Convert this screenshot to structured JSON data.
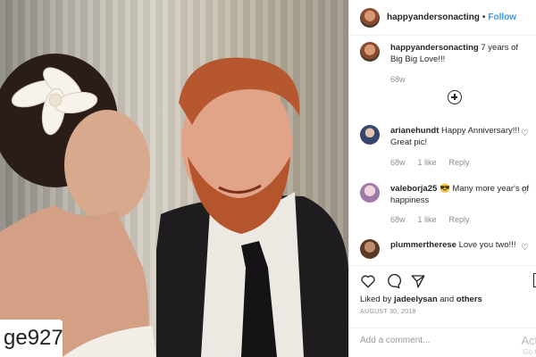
{
  "photo": {
    "watermark_text": "ge927"
  },
  "post_header": {
    "username": "happyandersonacting",
    "separator": "•",
    "follow_label": "Follow"
  },
  "caption": {
    "username": "happyandersonacting",
    "text": "7 years of Big Big Love!!!",
    "time": "68w"
  },
  "comments": [
    {
      "username": "arianehundt",
      "text": "Happy Anniversary!!! Great pic!",
      "time": "68w",
      "likes": "1 like",
      "reply": "Reply"
    },
    {
      "username": "valeborja25",
      "text": "😎 Many more year's of happiness",
      "time": "68w",
      "likes": "1 like",
      "reply": "Reply"
    },
    {
      "username": "plummertherese",
      "text": "Love you two!!!"
    }
  ],
  "engagement": {
    "liked_by_prefix": "Liked by",
    "liked_by_user": "jadeelysan",
    "and": "and",
    "others": "others",
    "date": "AUGUST 30, 2018"
  },
  "add_comment": {
    "placeholder": "Add a comment..."
  },
  "overlay": {
    "activate": "Acti",
    "activate_sub": "Go to"
  },
  "icons": {
    "load_more": "plus-circle-icon",
    "like": "heart-icon",
    "comment": "comment-bubble-icon",
    "share": "paper-plane-icon",
    "save": "bookmark-icon"
  },
  "colors": {
    "follow": "#3897f0",
    "muted": "#8e8e8e",
    "text": "#262626"
  }
}
